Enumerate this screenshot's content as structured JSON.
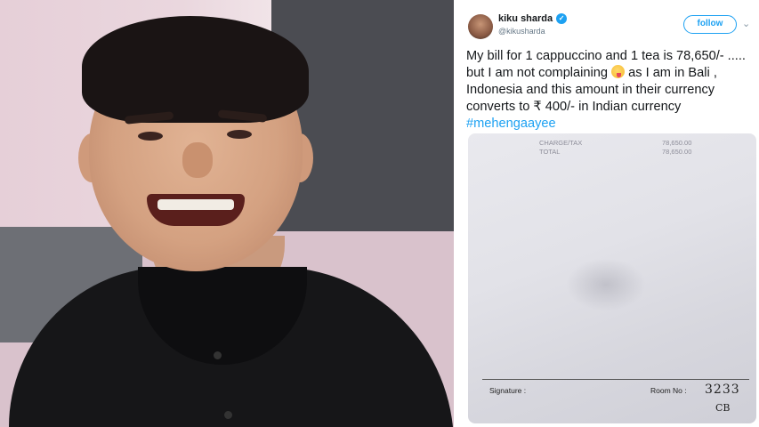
{
  "tweet": {
    "display_name": "kiku sharda",
    "handle": "@kikusharda",
    "verified_mark": "✓",
    "follow_label": "follow",
    "chevron": "⌄",
    "text_part1": "My bill for 1 cappuccino and 1 tea is 78,650/- ..... but I am not complaining ",
    "text_part2": " as I am in Bali , Indonesia and this amount in their currency converts to ₹ 400/- in Indian currency ",
    "hashtag": "#mehengaayee",
    "accent_color": "#1da1f2",
    "emoji_icon": "winking-face-with-tongue-icon"
  },
  "receipt": {
    "top_left_line1": "CHARGE/TAX",
    "top_left_line2": "TOTAL",
    "top_right_line1": "78,650.00",
    "top_right_line2": "78,650.00",
    "signature_label": "Signature :",
    "room_label": "Room No :",
    "handwritten_room": "3233",
    "handwritten_initials": "CB"
  }
}
